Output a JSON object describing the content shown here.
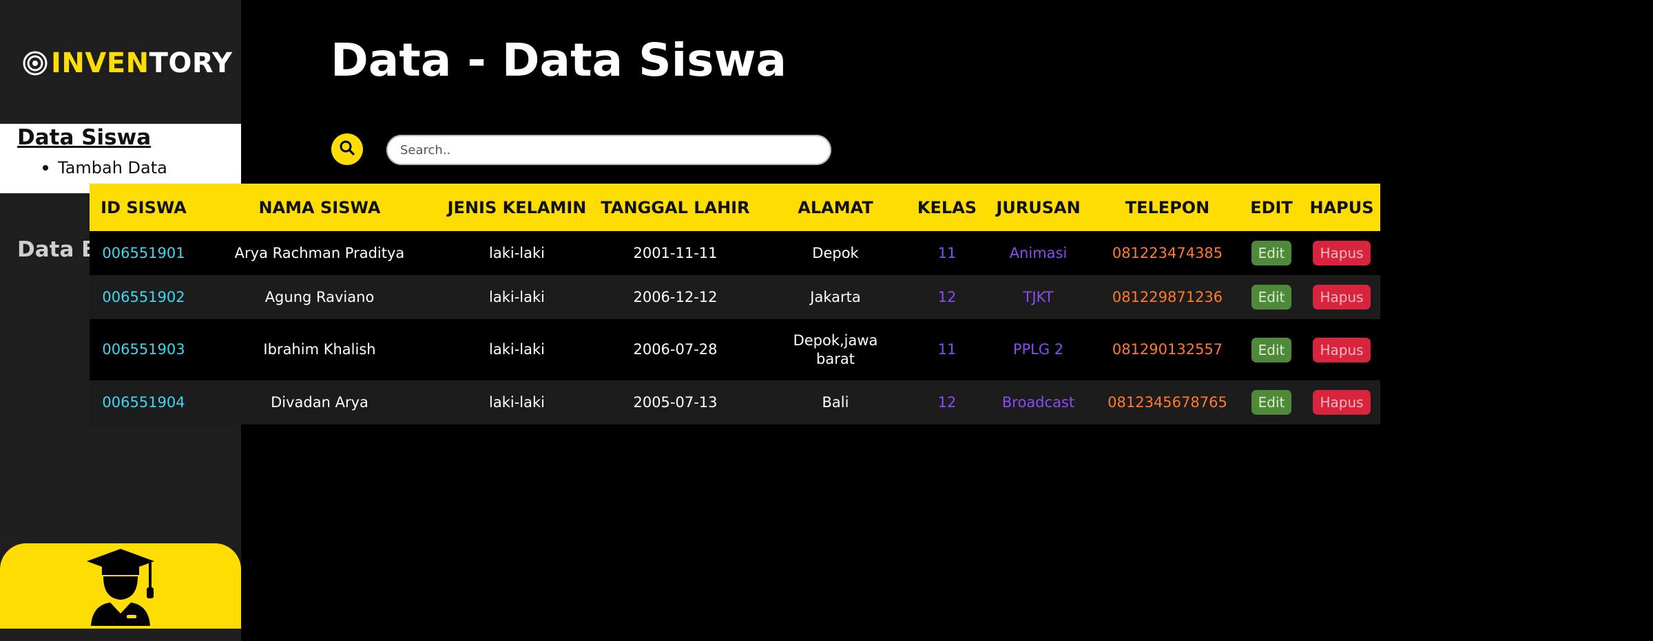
{
  "app": {
    "logo_part1": "INVEN",
    "logo_part2": "TORY",
    "logo_icon": "target-icon"
  },
  "sidebar": {
    "active_item": "Data Siswa",
    "sub_item": "Tambah Data",
    "item_barang": "Data Barang",
    "card_icon": "graduate-student-icon"
  },
  "page": {
    "title": "Data - Data Siswa"
  },
  "search": {
    "placeholder": "Search..",
    "icon": "search-icon"
  },
  "table": {
    "headers": [
      "ID SISWA",
      "NAMA SISWA",
      "JENIS KELAMIN",
      "TANGGAL LAHIR",
      "ALAMAT",
      "KELAS",
      "JURUSAN",
      "TELEPON",
      "EDIT",
      "HAPUS"
    ],
    "edit_label": "Edit",
    "delete_label": "Hapus",
    "rows": [
      {
        "id": "006551901",
        "nama": "Arya Rachman Praditya",
        "jk": "laki-laki",
        "tgl": "2001-11-11",
        "alamat": "Depok",
        "kelas": "11",
        "jurusan": "Animasi",
        "telepon": "081223474385"
      },
      {
        "id": "006551902",
        "nama": "Agung Raviano",
        "jk": "laki-laki",
        "tgl": "2006-12-12",
        "alamat": "Jakarta",
        "kelas": "12",
        "jurusan": "TJKT",
        "telepon": "081229871236"
      },
      {
        "id": "006551903",
        "nama": "Ibrahim Khalish",
        "jk": "laki-laki",
        "tgl": "2006-07-28",
        "alamat": "Depok,jawa barat",
        "kelas": "11",
        "jurusan": "PPLG 2",
        "telepon": "081290132557"
      },
      {
        "id": "006551904",
        "nama": "Divadan Arya",
        "jk": "laki-laki",
        "tgl": "2005-07-13",
        "alamat": "Bali",
        "kelas": "12",
        "jurusan": "Broadcast",
        "telepon": "0812345678765"
      }
    ]
  },
  "colors": {
    "accent": "#ffdd00",
    "sidebar_bg": "#1e1e1e",
    "id_text": "#3fd6f0",
    "kelas_jurusan_text": "#8a4cf2",
    "telepon_text": "#ff7a2a",
    "edit_button": "#4e8a3a",
    "delete_button": "#d8243d"
  }
}
